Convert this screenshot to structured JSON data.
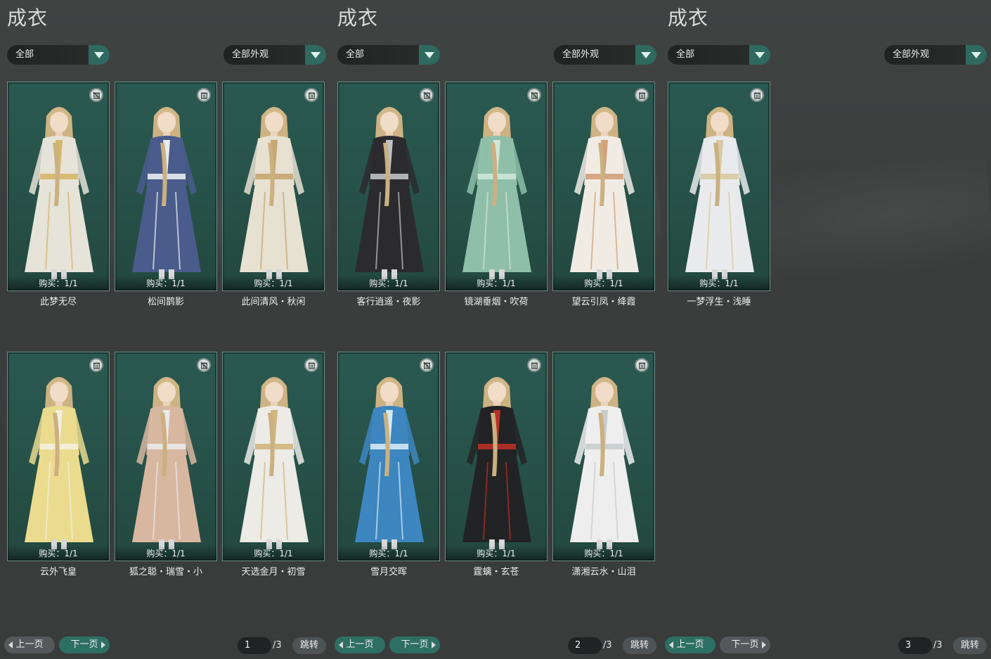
{
  "colors": {
    "card_bg": "#2a5951",
    "accent": "#2e6f64",
    "background": "#3a3d3d"
  },
  "panels": [
    {
      "title": "成衣",
      "filter_left": "全部",
      "filter_right": "全部外观",
      "cards": [
        {
          "name": "此梦无尽",
          "buy": "购买：1/1",
          "outfit": "#e6e3d8",
          "trim": "#d6b56a",
          "trash_disabled": true
        },
        {
          "name": "松间鹊影",
          "buy": "购买：1/1",
          "outfit": "#4a5c8c",
          "trim": "#e8ecef",
          "trash_disabled": false
        },
        {
          "name": "此间清风・秋闲",
          "buy": "购买：1/1",
          "outfit": "#e7e1d2",
          "trim": "#c7a670",
          "trash_disabled": false
        },
        {
          "name": "云外飞皇",
          "buy": "购买：1/1",
          "outfit": "#eadb8e",
          "trim": "#f3efe0",
          "trash_disabled": false
        },
        {
          "name": "狐之聪・瑞雪・小",
          "buy": "购买：1/1",
          "outfit": "#d8b7a0",
          "trim": "#e9e9e9",
          "trash_disabled": true
        },
        {
          "name": "天选金月・初雪",
          "buy": "购买：1/1",
          "outfit": "#ecebe6",
          "trim": "#d2b67c",
          "trash_disabled": false
        }
      ],
      "prev": "上一页",
      "next": "下一页",
      "page": "1",
      "total": "/3",
      "jump": "跳转"
    },
    {
      "title": "成衣",
      "filter_left": "全部",
      "filter_right": "全部外观",
      "cards": [
        {
          "name": "客行逍遥・夜影",
          "buy": "购买：1/1",
          "outfit": "#2b2b2e",
          "trim": "#bfc1c4",
          "trash_disabled": true
        },
        {
          "name": "镜湖垂烟・吹荷",
          "buy": "购买：1/1",
          "outfit": "#8fbfa8",
          "trim": "#cfe5da",
          "trash_disabled": true
        },
        {
          "name": "望云引凤・绛霞",
          "buy": "购买：1/1",
          "outfit": "#f0ece4",
          "trim": "#d3a07a",
          "trash_disabled": false
        },
        {
          "name": "雪月交晖",
          "buy": "购买：1/1",
          "outfit": "#3d86bf",
          "trim": "#d5e9f4",
          "trash_disabled": true
        },
        {
          "name": "霆螭・玄苍",
          "buy": "购买：1/1",
          "outfit": "#222325",
          "trim": "#b73028",
          "trash_disabled": false
        },
        {
          "name": "潇湘云水・山泪",
          "buy": "购买：1/1",
          "outfit": "#eeeeee",
          "trim": "#c9cccc",
          "trash_disabled": false
        }
      ],
      "prev": "上一页",
      "next": "下一页",
      "page": "2",
      "total": "/3",
      "jump": "跳转"
    },
    {
      "title": "成衣",
      "filter_left": "全部",
      "filter_right": "全部外观",
      "cards": [
        {
          "name": "一梦浮生・浅睡",
          "buy": "购买：1/1",
          "outfit": "#e9eaec",
          "trim": "#d8c9a2",
          "trash_disabled": false
        }
      ],
      "prev": "上一页",
      "next": "下一页",
      "page": "3",
      "total": "/3",
      "jump": "跳转"
    }
  ]
}
